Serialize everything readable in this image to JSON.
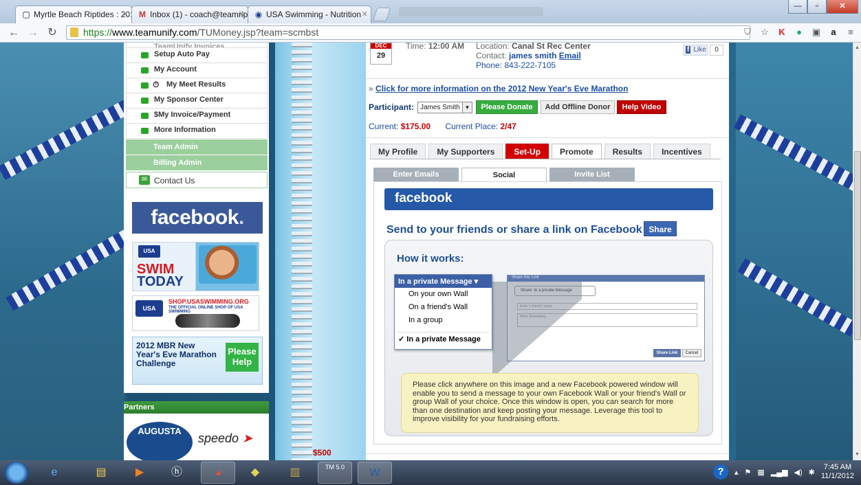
{
  "browser": {
    "tabs": [
      {
        "title": "Myrtle Beach Riptides : 201",
        "icon": "page-icon",
        "active": true
      },
      {
        "title": "Inbox (1) - coach@teamrip",
        "icon": "gmail-icon",
        "active": false
      },
      {
        "title": "USA Swimming - Nutrition",
        "icon": "usa-swimming-icon",
        "active": false
      }
    ],
    "url_scheme": "https://",
    "url_host": "www.teamunify.com",
    "url_path": "/TUMoney.jsp?team=scmbst"
  },
  "sidebar": {
    "top_item": "TeamUnify Invoices",
    "items": [
      {
        "label": "Setup Auto Pay"
      },
      {
        "label": "My Account"
      },
      {
        "label": "My Meet Results"
      },
      {
        "label": "My Sponsor Center"
      },
      {
        "label": "$My Invoice/Payment"
      },
      {
        "label": "More Information"
      }
    ],
    "groups": [
      "Team Admin",
      "Billing Admin"
    ],
    "contact": "Contact Us",
    "facebook_text": "facebook",
    "facebook_dot": ".",
    "swim_today": {
      "line1": "SWIM",
      "line2": "TODAY",
      "badge": "USA"
    },
    "shop": {
      "url": "SHOP.USASWIMMING.ORG",
      "tagline": "THE OFFICIAL ONLINE SHOP OF USA SWIMMING",
      "badge": "USA"
    },
    "mbr": {
      "text": "2012 MBR New Year's Eve Marathon Challenge",
      "help": "Please Help"
    },
    "partners_title": "Partners",
    "partner_augusta": "AUGUSTA",
    "partner_speedo": "speedo"
  },
  "spiral": {
    "amount": "$500"
  },
  "event": {
    "month": "DEC",
    "day": "29",
    "time_label": "Time:",
    "time": "12:00 AM",
    "location_label": "Location:",
    "location": "Canal St Rec Center",
    "contact_label": "Contact:",
    "contact_name": "james smith",
    "email_link": "Email",
    "phone": "Phone: 843-222-7105",
    "like": "Like",
    "like_count": "0"
  },
  "marathon": {
    "prefix": "»",
    "link": "Click for more information on the 2012 New Year's Eve Marathon",
    "participant_label": "Participant:",
    "participant": "James Smith",
    "donate": "Please Donate",
    "offline": "Add Offline Donor",
    "help_video": "Help Video",
    "current_label": "Current:",
    "current": "$175.00",
    "place_label": "Current Place:",
    "place": "2/47"
  },
  "tabs": [
    "My Profile",
    "My Supporters",
    "Set-Up",
    "Promote",
    "Results",
    "Incentives"
  ],
  "subtabs": [
    "Enter Emails",
    "Social",
    "Invite List"
  ],
  "promote": {
    "fb_bar": "facebook",
    "send_text": "Send to your friends or share a link on Facebook",
    "share_btn": "Share",
    "how_title": "How it works:",
    "dropdown_header": "In a private Message",
    "options": [
      "On your own Wall",
      "On a friend's Wall",
      "In a group"
    ],
    "checked_option": "In a private Message",
    "preview_header": "Share this Link",
    "preview_share_to": "Share: In a private Message",
    "preview_field1": "Enter a friend's name",
    "preview_field2": "Write Something...",
    "preview_share_link": "Share Link",
    "preview_cancel": "Cancel",
    "note": "Please click anywhere on this image and a new Facebook powered window will enable you to send a message to your own Facebook Wall or your friend's Wall or group Wall of your choice. Once this window is open, you can search for more than one destination and keep posting your message. Leverage this tool to improve visibility for your fundraising efforts."
  },
  "taskbar": {
    "time": "7:45 AM",
    "date": "11/1/2012",
    "tm_label": "TM 5.0"
  }
}
